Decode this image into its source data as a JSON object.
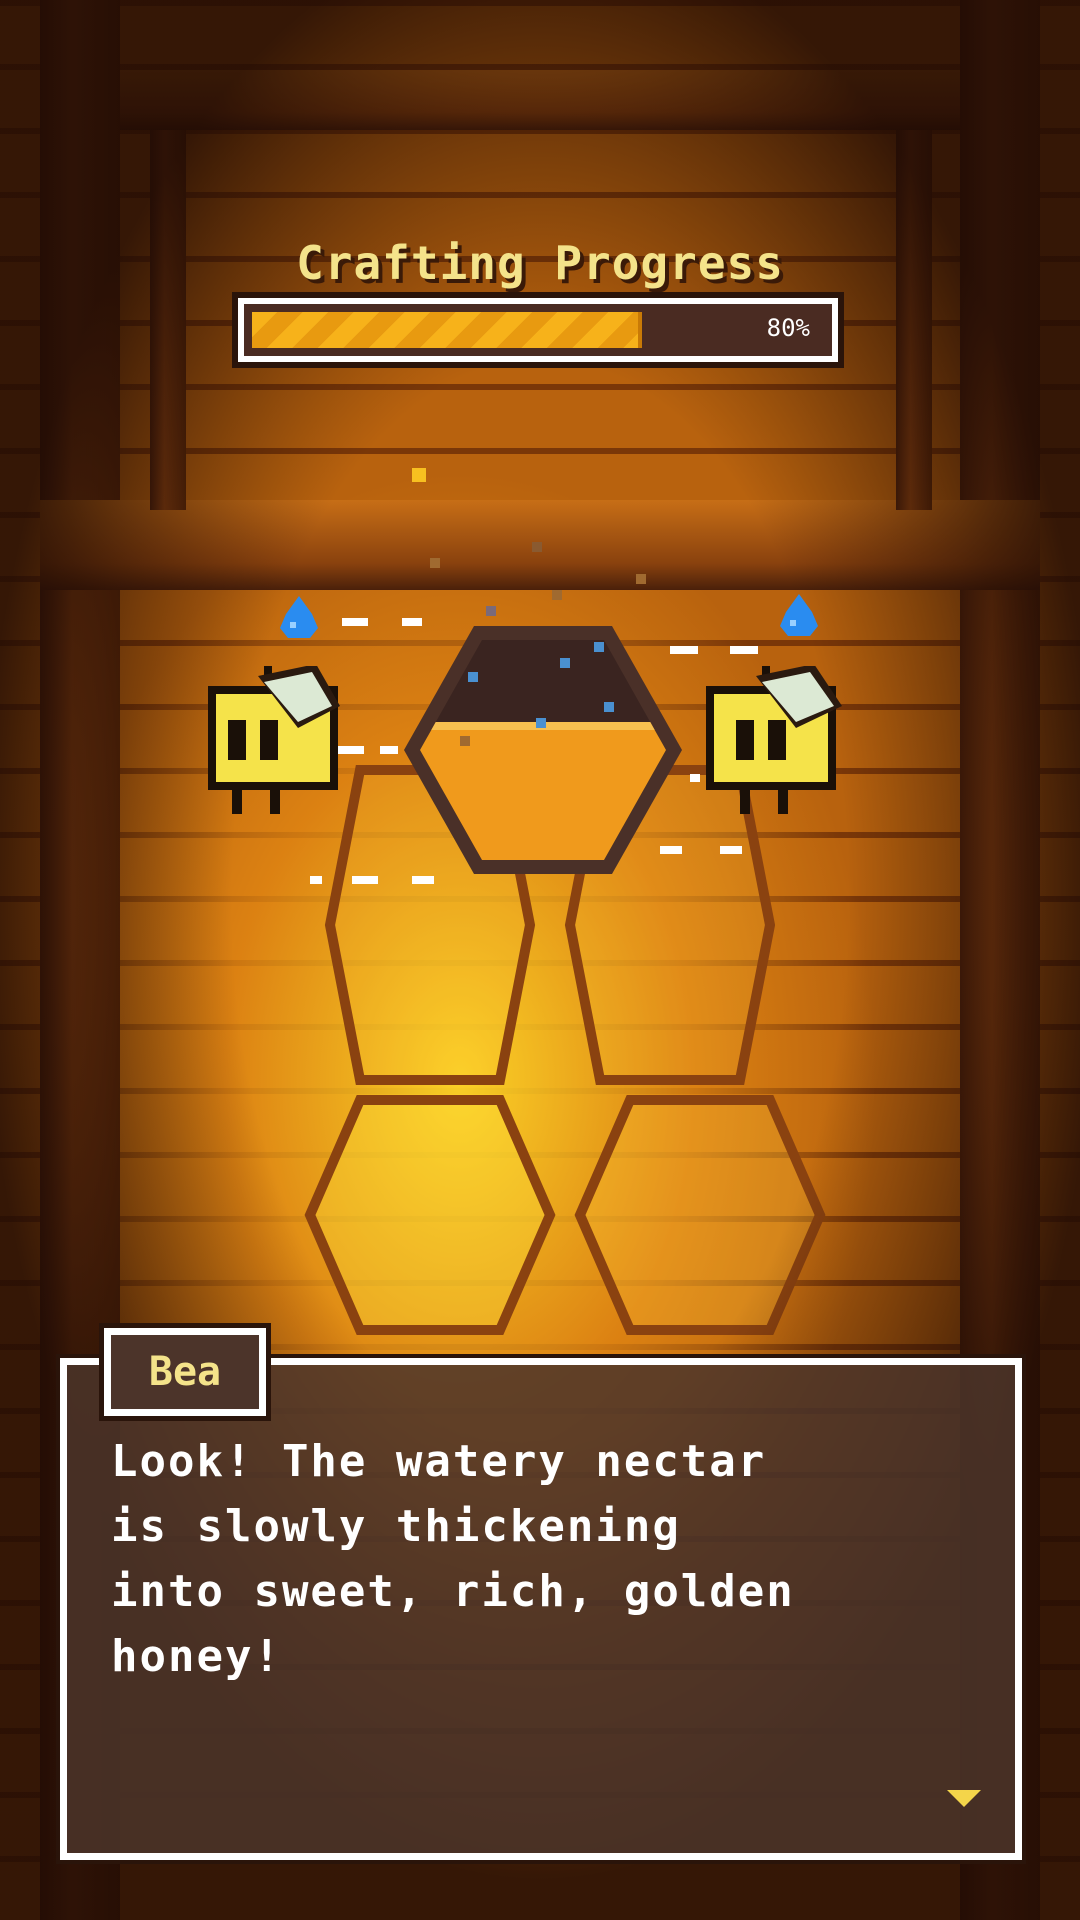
{
  "progress": {
    "title": "Crafting Progress",
    "value": 0.8,
    "label": "80%"
  },
  "dialog": {
    "speaker": "Bea",
    "text": "Look! The watery nectar\nis slowly thickening\ninto sweet, rich, golden\nhoney!",
    "advance_icon": "triangle-down-icon"
  },
  "scene": {
    "center_object": "honeycomb-honey-pot",
    "characters": [
      "bee-left",
      "bee-right"
    ],
    "icons": [
      "water-drop-icon",
      "water-drop-icon"
    ]
  },
  "colors": {
    "accent": "#f4e38a",
    "honey": "#f0a020",
    "bee_yellow": "#f5e34a",
    "water": "#2a8cf0",
    "panel": "#4c342a"
  }
}
